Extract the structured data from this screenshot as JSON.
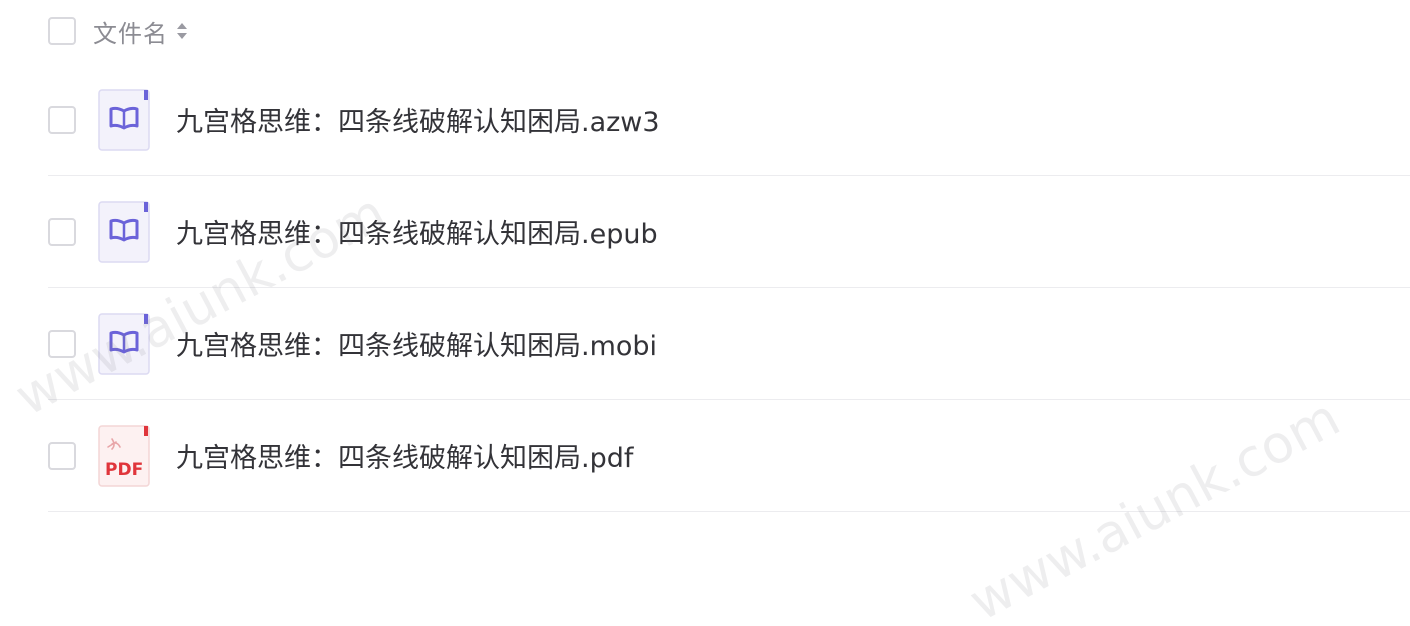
{
  "header": {
    "column_label": "文件名",
    "sort_icon": "sort-icon"
  },
  "files": [
    {
      "name": "九宫格思维：四条线破解认知困局.azw3",
      "icon": "ebook-icon"
    },
    {
      "name": "九宫格思维：四条线破解认知困局.epub",
      "icon": "ebook-icon"
    },
    {
      "name": "九宫格思维：四条线破解认知困局.mobi",
      "icon": "ebook-icon"
    },
    {
      "name": "九宫格思维：四条线破解认知困局.pdf",
      "icon": "pdf-file-icon",
      "icon_label": "PDF"
    }
  ],
  "watermark": "www.aiunk.com",
  "colors": {
    "ebook_accent": "#6b63d9",
    "ebook_bg": "#f3f2fb",
    "pdf_accent": "#e0353b",
    "pdf_bg": "#fdf1f1"
  }
}
